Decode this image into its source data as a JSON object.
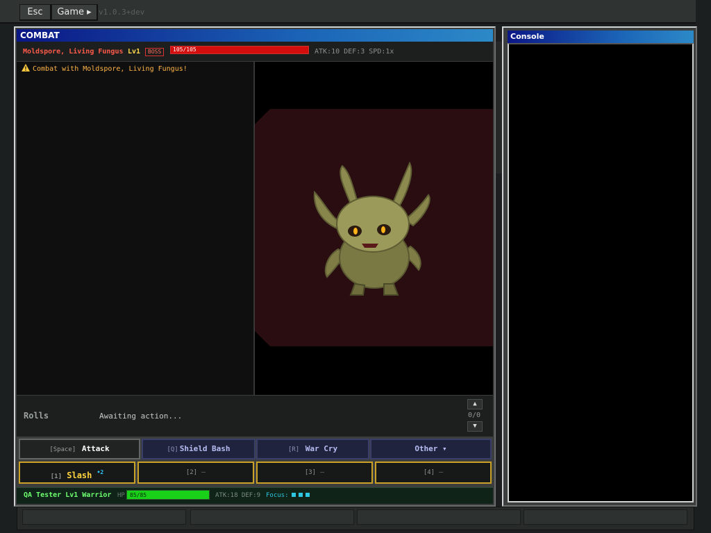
{
  "menubar": {
    "esc_label": "Esc",
    "game_label": "Game ▸",
    "version": "v1.0.3+dev"
  },
  "combat_window": {
    "title": "COMBAT"
  },
  "enemy": {
    "name": "Moldspore, Living Fungus",
    "level": "Lv1",
    "badge": "BOSS",
    "hp_text": "105/105",
    "hp_fraction": 1.0,
    "stats": "ATK:10 DEF:3 SPD:1x"
  },
  "log": {
    "lines": [
      "Combat with Moldspore, Living Fungus!"
    ]
  },
  "rolls": {
    "label": "Rolls",
    "status": "Awaiting action...",
    "up": "▲",
    "down": "▼",
    "count": "0/0"
  },
  "actions": [
    {
      "key": "[Space]",
      "label": "Attack"
    },
    {
      "key": "[Q]",
      "label": "Shield Bash"
    },
    {
      "key": "[R]",
      "label": "War Cry"
    },
    {
      "key": "",
      "label": "Other ▾"
    }
  ],
  "skills": [
    {
      "key": "[1]",
      "label": "Slash",
      "mult": "•2"
    },
    {
      "key": "[2]",
      "label": "—"
    },
    {
      "key": "[3]",
      "label": "—"
    },
    {
      "key": "[4]",
      "label": "—"
    }
  ],
  "player": {
    "name": "QA Tester Lv1 Warrior",
    "hp_label": "HP",
    "hp_text": "85/85",
    "hp_fraction": 1.0,
    "stats": "ATK:18 DEF:9",
    "focus_label": "Focus:",
    "focus_pips": 3
  },
  "console_window": {
    "title": "Console"
  },
  "colors": {
    "accent_title": "#0b1785",
    "enemy_red": "#ff5a4a",
    "player_green": "#6fff6f",
    "skill_gold": "#c9a227"
  }
}
